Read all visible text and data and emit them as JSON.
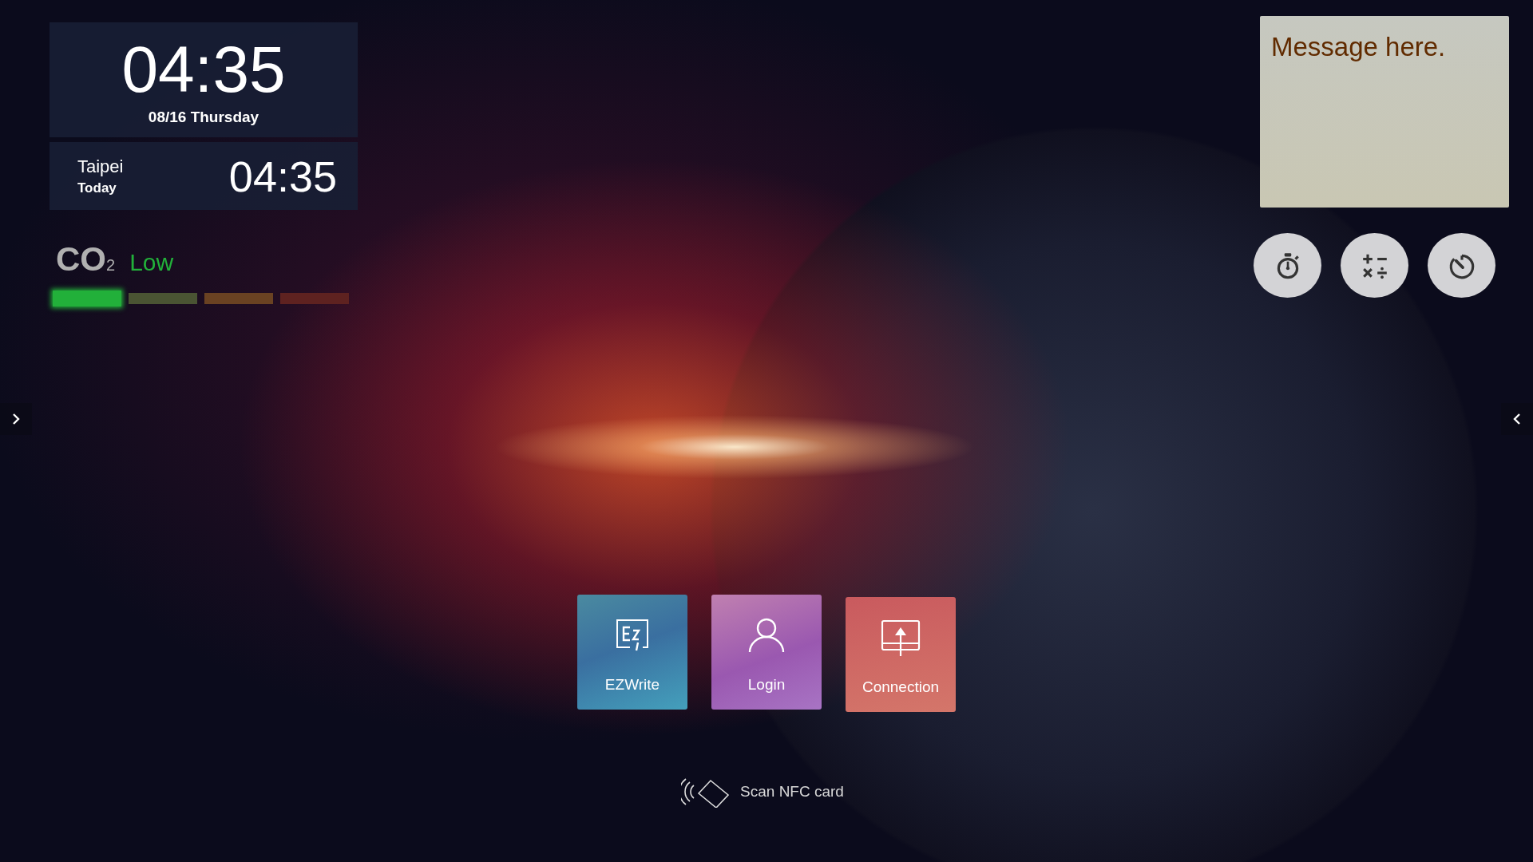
{
  "clock": {
    "time": "04:35",
    "date": "08/16 Thursday"
  },
  "world_clock": {
    "city": "Taipei",
    "day": "Today",
    "time": "04:35"
  },
  "co2": {
    "label": "CO$_{2}$",
    "reading": "Low",
    "color": "#22b03a",
    "segments": [
      {
        "color": "#22b03a",
        "active": true
      },
      {
        "color": "#4a5433",
        "active": false
      },
      {
        "color": "#6a4222",
        "active": false
      },
      {
        "color": "#5e2220",
        "active": false
      }
    ]
  },
  "message_note": {
    "text": "Message here."
  },
  "tool_buttons": [
    {
      "kind": "stopwatch"
    },
    {
      "kind": "calculator"
    },
    {
      "kind": "timer"
    }
  ],
  "app_tiles": [
    {
      "kind": "ezwrite",
      "label": "EZWrite"
    },
    {
      "kind": "login",
      "label": "Login"
    },
    {
      "kind": "connection",
      "label": "Connection"
    }
  ],
  "nfc_prompt": {
    "text": "Scan NFC card"
  },
  "side_arrows": [
    {
      "kind": "point_right"
    },
    {
      "kind": "point_left"
    }
  ]
}
